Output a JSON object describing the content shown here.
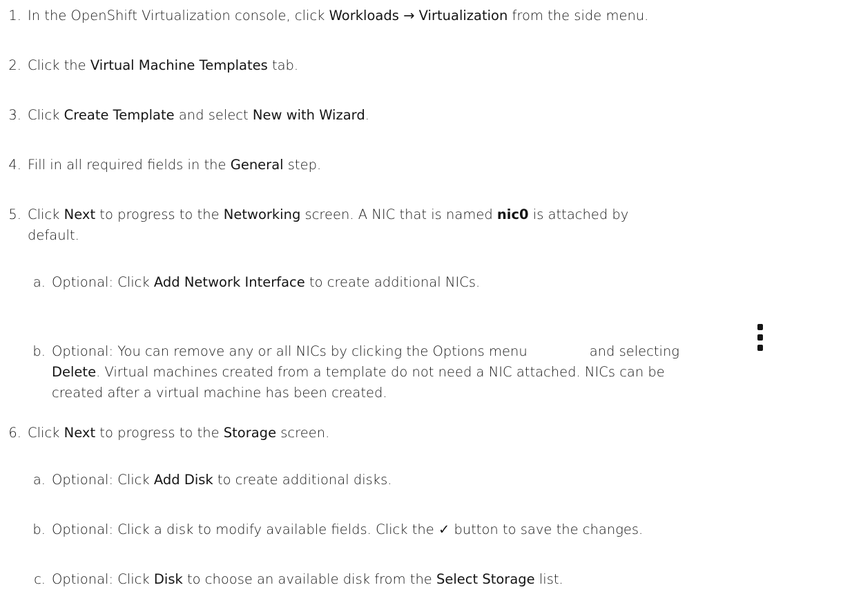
{
  "steps": [
    {
      "num": "1.",
      "parts": [
        "In the OpenShift Virtualization console, click ",
        "Workloads",
        " → ",
        "Virtualization",
        " from the side menu."
      ]
    },
    {
      "num": "2.",
      "parts": [
        "Click the ",
        "Virtual Machine Templates",
        " tab."
      ]
    },
    {
      "num": "3.",
      "parts": [
        "Click ",
        "Create Template",
        " and select ",
        "New with Wizard",
        "."
      ]
    },
    {
      "num": "4.",
      "parts": [
        "Fill in all required fields in the ",
        "General",
        " step."
      ]
    },
    {
      "num": "5.",
      "line1": [
        "Click ",
        "Next",
        " to progress to the ",
        "Networking",
        " screen. A NIC that is named ",
        "nic0",
        " is attached by"
      ],
      "line2": "default.",
      "substeps": [
        {
          "num": "a.",
          "parts": [
            "Optional: Click ",
            "Add Network Interface",
            " to create additional NICs."
          ]
        },
        {
          "num": "b.",
          "line1": [
            "Optional: You can remove any or all NICs by clicking the Options menu",
            "and selecting"
          ],
          "line2": [
            "Delete",
            ". Virtual machines created from a template do not need a NIC attached. NICs can be"
          ],
          "line3": "created after a virtual machine has been created."
        }
      ]
    },
    {
      "num": "6.",
      "parts": [
        "Click ",
        "Next",
        " to progress to the ",
        "Storage",
        " screen."
      ],
      "substeps": [
        {
          "num": "a.",
          "parts": [
            "Optional: Click ",
            "Add Disk",
            " to create additional disks."
          ]
        },
        {
          "num": "b.",
          "parts": [
            "Optional: Click a disk to modify available fields. Click the ✓ button to save the changes."
          ]
        },
        {
          "num": "c.",
          "parts": [
            "Optional: Click ",
            "Disk",
            " to choose an available disk from the ",
            "Select Storage",
            " list."
          ]
        }
      ]
    }
  ],
  "icons": {
    "options_menu": "kebab-vertical-icon"
  }
}
